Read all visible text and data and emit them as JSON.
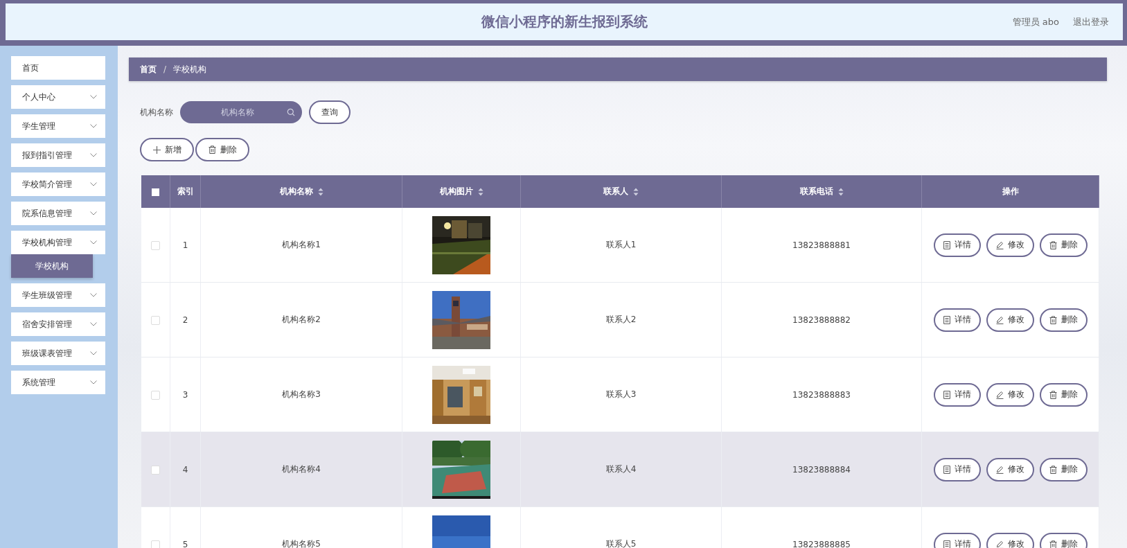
{
  "header": {
    "title": "微信小程序的新生报到系统",
    "user": "管理员 abo",
    "logout": "退出登录"
  },
  "sidebar": {
    "items": [
      {
        "label": "首页",
        "kind": "link",
        "expanded": false
      },
      {
        "label": "个人中心",
        "kind": "menu",
        "expanded": false
      },
      {
        "label": "学生管理",
        "kind": "menu",
        "expanded": false
      },
      {
        "label": "报到指引管理",
        "kind": "menu",
        "expanded": false
      },
      {
        "label": "学校简介管理",
        "kind": "menu",
        "expanded": false
      },
      {
        "label": "院系信息管理",
        "kind": "menu",
        "expanded": false
      },
      {
        "label": "学校机构管理",
        "kind": "menu",
        "expanded": true,
        "children": [
          {
            "label": "学校机构",
            "selected": true
          }
        ]
      },
      {
        "label": "学生班级管理",
        "kind": "menu",
        "expanded": false
      },
      {
        "label": "宿舍安排管理",
        "kind": "menu",
        "expanded": false
      },
      {
        "label": "班级课表管理",
        "kind": "menu",
        "expanded": false
      },
      {
        "label": "系统管理",
        "kind": "menu",
        "expanded": false
      }
    ]
  },
  "breadcrumb": {
    "items": [
      "首页",
      "学校机构"
    ],
    "separator": "/"
  },
  "search": {
    "label": "机构名称",
    "placeholder": "机构名称",
    "button": "查询"
  },
  "actions": [
    {
      "kind": "add",
      "label": "新增"
    },
    {
      "kind": "delete",
      "label": "删除"
    }
  ],
  "table": {
    "columns": [
      {
        "kind": "checkbox",
        "checked": false
      },
      {
        "kind": "text",
        "label": "索引",
        "sortable": false
      },
      {
        "kind": "text",
        "label": "机构名称",
        "sortable": true
      },
      {
        "label": "机构图片",
        "sortable": true
      },
      {
        "kind": "text",
        "label": "联系人",
        "sortable": true
      },
      {
        "kind": "text",
        "label": "联系电话",
        "sortable": true
      },
      {
        "kind": "ops",
        "label": "操作",
        "sortable": false
      }
    ],
    "rows": [
      {
        "checked": false,
        "hovered": false,
        "index": "1",
        "name": "机构名称1",
        "contact": "联系人1",
        "phone": "13823888881",
        "ops": [
          {
            "kind": "detail",
            "label": "详情"
          },
          {
            "kind": "edit",
            "label": "修改"
          },
          {
            "kind": "delete",
            "label": "删除"
          }
        ]
      },
      {
        "checked": false,
        "hovered": false,
        "index": "2",
        "name": "机构名称2",
        "contact": "联系人2",
        "phone": "13823888882",
        "ops": [
          {
            "kind": "detail",
            "label": "详情"
          },
          {
            "kind": "edit",
            "label": "修改"
          },
          {
            "kind": "delete",
            "label": "删除"
          }
        ]
      },
      {
        "checked": false,
        "hovered": false,
        "index": "3",
        "name": "机构名称3",
        "contact": "联系人3",
        "phone": "13823888883",
        "ops": [
          {
            "kind": "detail",
            "label": "详情"
          },
          {
            "kind": "edit",
            "label": "修改"
          },
          {
            "kind": "delete",
            "label": "删除"
          }
        ]
      },
      {
        "checked": false,
        "hovered": true,
        "index": "4",
        "name": "机构名称4",
        "contact": "联系人4",
        "phone": "13823888884",
        "ops": [
          {
            "kind": "detail",
            "label": "详情"
          },
          {
            "kind": "edit",
            "label": "修改"
          },
          {
            "kind": "delete",
            "label": "删除"
          }
        ]
      },
      {
        "checked": false,
        "hovered": false,
        "index": "5",
        "name": "机构名称5",
        "contact": "联系人5",
        "phone": "13823888885",
        "ops": [
          {
            "kind": "detail",
            "label": "详情"
          },
          {
            "kind": "edit",
            "label": "修改"
          },
          {
            "kind": "delete",
            "label": "删除"
          }
        ]
      }
    ]
  }
}
